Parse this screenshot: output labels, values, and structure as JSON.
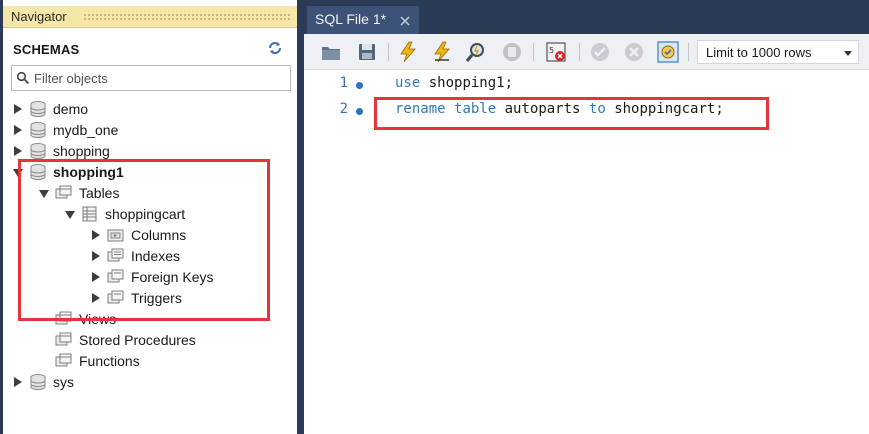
{
  "navigator": {
    "title": "Navigator",
    "schemas_label": "SCHEMAS",
    "filter_placeholder": "Filter objects",
    "tree": {
      "demo": "demo",
      "mydb_one": "mydb_one",
      "shopping": "shopping",
      "shopping1": "shopping1",
      "tables": "Tables",
      "shoppingcart": "shoppingcart",
      "columns": "Columns",
      "indexes": "Indexes",
      "foreign_keys": "Foreign Keys",
      "triggers": "Triggers",
      "views": "Views",
      "stored_procedures": "Stored Procedures",
      "functions": "Functions",
      "sys": "sys"
    }
  },
  "editor": {
    "tab_label": "SQL File 1*",
    "limit_label": "Limit to 1000 rows",
    "lines": [
      {
        "number": "1",
        "kw1": "use",
        "rest1": " shopping1;"
      },
      {
        "number": "2",
        "kw1": "rename",
        "kw2": "table",
        "ident1": "autoparts",
        "kw3": "to",
        "ident2": "shoppingcart;"
      }
    ]
  },
  "colors": {
    "keyword": "#2b7bbf",
    "highlight_border": "#e8323c",
    "tab_bar": "#2b3a55",
    "navigator_header": "#f4e7a8"
  },
  "icons": {
    "toolbar": [
      "open-file-icon",
      "save-icon",
      "execute-icon",
      "execute-current-icon",
      "explain-icon",
      "stop-icon",
      "toggle-error-icon",
      "commit-icon",
      "rollback-icon",
      "autocommit-icon"
    ]
  }
}
